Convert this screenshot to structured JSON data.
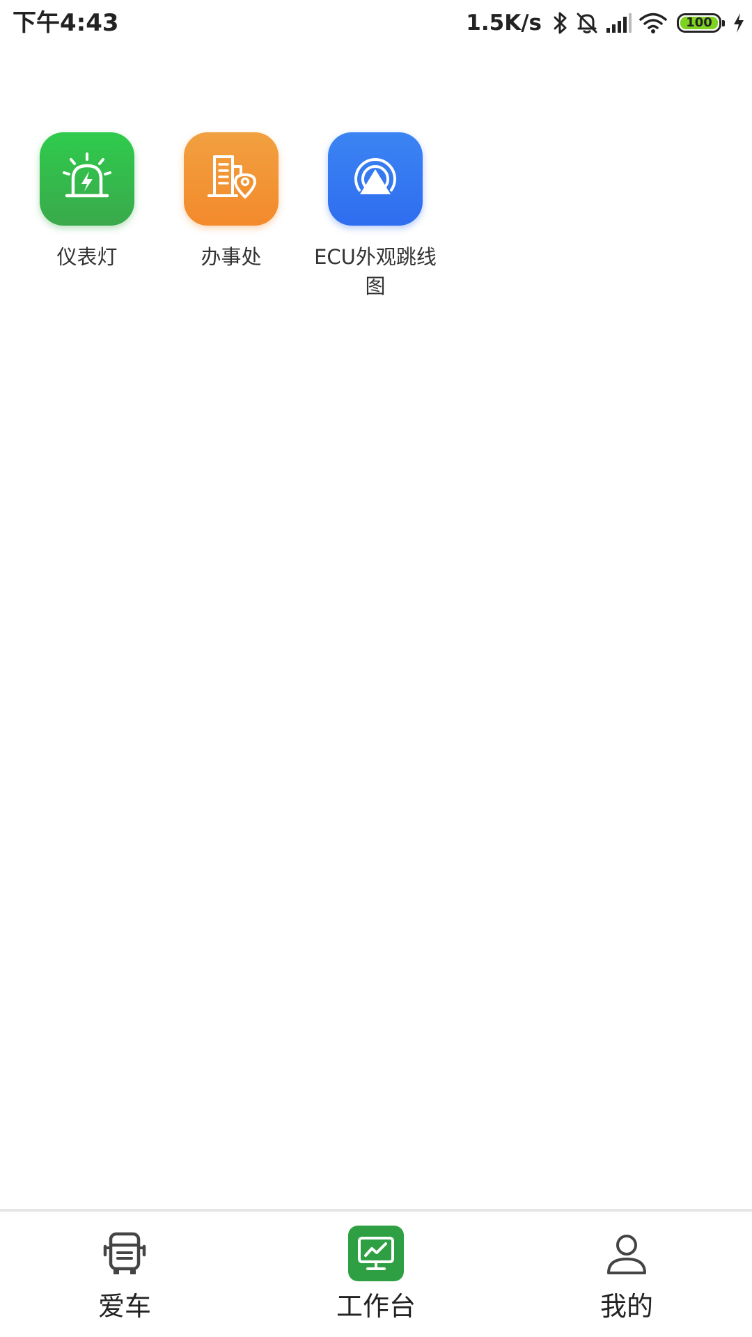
{
  "status_bar": {
    "time": "下午4:43",
    "net_speed": "1.5K/s",
    "battery_level": "100",
    "battery_color": "#7ed321"
  },
  "apps": [
    {
      "label": "仪表灯",
      "icon": "warning-beacon-icon",
      "color": "#34b84c"
    },
    {
      "label": "办事处",
      "icon": "office-building-location-icon",
      "color": "#f2922f"
    },
    {
      "label": "ECU外观跳线图",
      "icon": "signal-broadcast-icon",
      "color": "#3278f1"
    }
  ],
  "bottom_nav": {
    "items": [
      {
        "label": "爱车",
        "icon": "truck-icon",
        "active": false
      },
      {
        "label": "工作台",
        "icon": "monitor-chart-icon",
        "active": true
      },
      {
        "label": "我的",
        "icon": "person-icon",
        "active": false
      }
    ],
    "active_color": "#2ea043"
  }
}
